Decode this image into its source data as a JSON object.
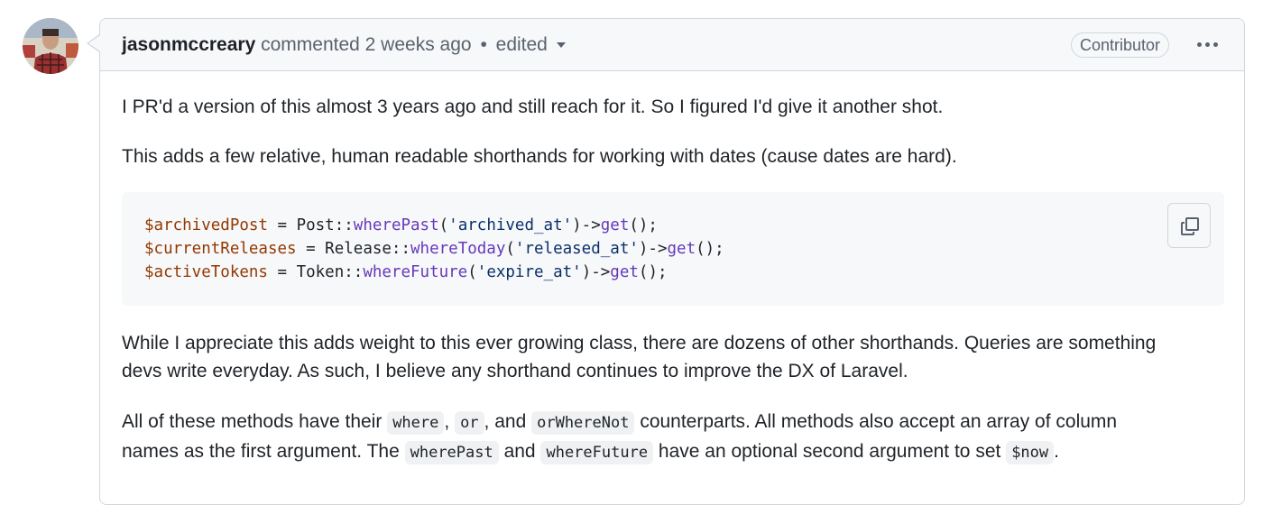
{
  "comment": {
    "author": "jasonmccreary",
    "action": "commented",
    "time": "2 weeks ago",
    "separator": "•",
    "edited": "edited",
    "role_badge": "Contributor",
    "menu_icon": "kebab-horizontal-icon"
  },
  "body": {
    "p1": "I PR'd a version of this almost 3 years ago and still reach for it. So I figured I'd give it another shot.",
    "p2": "This adds a few relative, human readable shorthands for working with dates (cause dates are hard).",
    "code": {
      "copy_icon": "copy-icon",
      "lines": [
        [
          {
            "t": "$archivedPost",
            "c": "var"
          },
          {
            "t": " = Post::",
            "c": "plain"
          },
          {
            "t": "wherePast",
            "c": "fn"
          },
          {
            "t": "(",
            "c": "plain"
          },
          {
            "t": "'archived_at'",
            "c": "str"
          },
          {
            "t": ")->",
            "c": "plain"
          },
          {
            "t": "get",
            "c": "fn"
          },
          {
            "t": "();",
            "c": "plain"
          }
        ],
        [
          {
            "t": "$currentReleases",
            "c": "var"
          },
          {
            "t": " = Release::",
            "c": "plain"
          },
          {
            "t": "whereToday",
            "c": "fn"
          },
          {
            "t": "(",
            "c": "plain"
          },
          {
            "t": "'released_at'",
            "c": "str"
          },
          {
            "t": ")->",
            "c": "plain"
          },
          {
            "t": "get",
            "c": "fn"
          },
          {
            "t": "();",
            "c": "plain"
          }
        ],
        [
          {
            "t": "$activeTokens",
            "c": "var"
          },
          {
            "t": " = Token::",
            "c": "plain"
          },
          {
            "t": "whereFuture",
            "c": "fn"
          },
          {
            "t": "(",
            "c": "plain"
          },
          {
            "t": "'expire_at'",
            "c": "str"
          },
          {
            "t": ")->",
            "c": "plain"
          },
          {
            "t": "get",
            "c": "fn"
          },
          {
            "t": "();",
            "c": "plain"
          }
        ]
      ]
    },
    "p3": {
      "line1": "While I appreciate this adds weight to this ever growing class, there are dozens of other shorthands. Queries are something",
      "line2": "devs write everyday. As such, I believe any shorthand continues to improve the DX of Laravel."
    },
    "p4": {
      "a": "All of these methods have their",
      "code1": "where",
      "b": ",",
      "code2": "or",
      "c": ", and",
      "code3": "orWhereNot",
      "d": "counterparts. All methods also accept an array of column",
      "e": "names as the first argument. The",
      "code4": "wherePast",
      "f": "and",
      "code5": "whereFuture",
      "g": "have an optional second argument to set",
      "code6": "$now",
      "h": "."
    }
  },
  "colors": {
    "header_bg": "#f6f8fa",
    "border": "#d0d7de",
    "code_var": "#953800",
    "code_fn": "#6639ba",
    "code_str": "#0a3069"
  }
}
